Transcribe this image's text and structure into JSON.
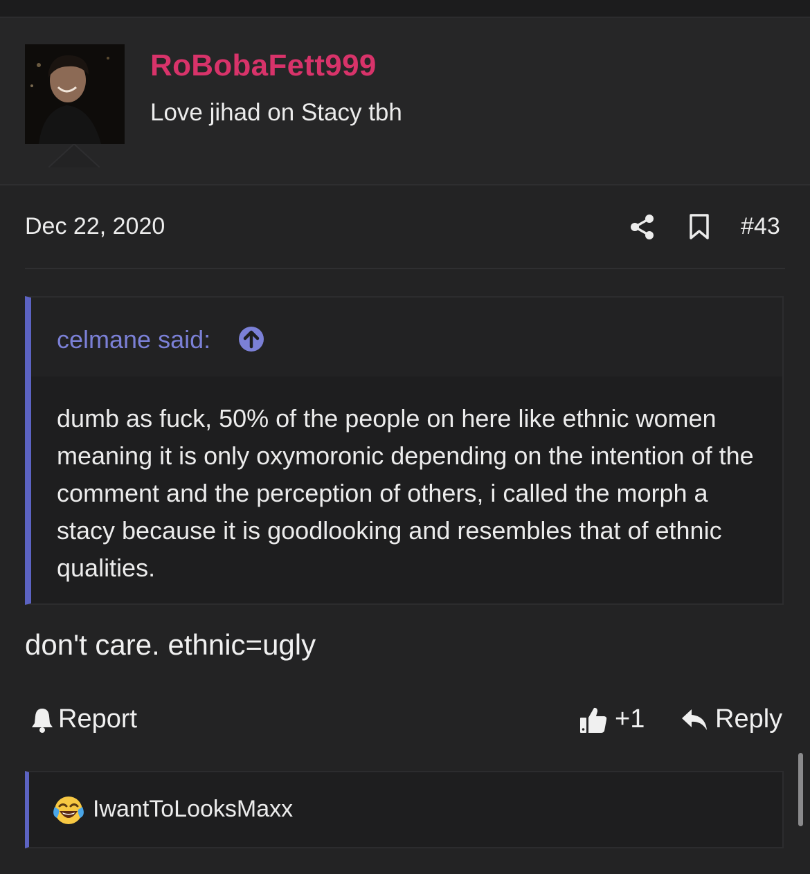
{
  "post": {
    "username": "RoBobaFett999",
    "user_title": "Love jihad on Stacy tbh",
    "date": "Dec 22, 2020",
    "post_number": "#43",
    "quote": {
      "author": "celmane said:",
      "text": "dumb as fuck, 50% of the people on here like ethnic women meaning it is only oxymoronic depending on the intention of the comment and the perception of others, i called the morph a stacy because it is goodlooking and resembles that of ethnic qualities."
    },
    "body": "don't care. ethnic=ugly"
  },
  "actions": {
    "report_label": "Report",
    "like_count": "+1",
    "reply_label": "Reply"
  },
  "reactions": {
    "user": "IwantToLooksMaxx",
    "emoji": "face-with-tears-of-joy"
  },
  "colors": {
    "accent": "#5c63c2",
    "username": "#d8336a",
    "quote_author": "#7b80d6",
    "background": "#232324"
  }
}
